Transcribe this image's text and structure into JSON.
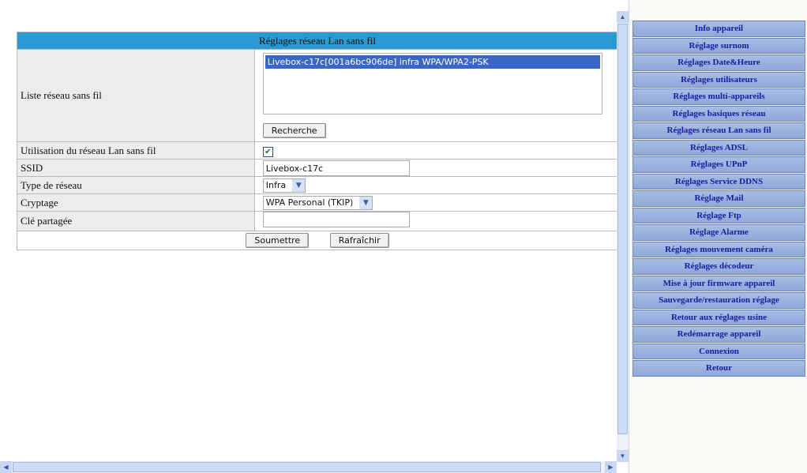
{
  "form": {
    "title": "Réglages réseau Lan sans fil",
    "wireless_list_label": "Liste réseau sans fil",
    "wireless_list_items": [
      "Livebox-c17c[001a6bc906de] infra WPA/WPA2-PSK"
    ],
    "search_button": "Recherche",
    "use_wlan_label": "Utilisation du réseau Lan sans fil",
    "use_wlan_checked": true,
    "ssid_label": "SSID",
    "ssid_value": "Livebox-c17c",
    "network_type_label": "Type de réseau",
    "network_type_value": "Infra",
    "encryption_label": "Cryptage",
    "encryption_value": "WPA Personal (TKIP)",
    "shared_key_label": "Clé partagée",
    "shared_key_value": "",
    "submit_button": "Soumettre",
    "refresh_button": "Rafraîchir"
  },
  "menu": {
    "items": [
      "Info appareil",
      "Réglage surnom",
      "Réglages Date&Heure",
      "Réglages utilisateurs",
      "Réglages multi-appareils",
      "Réglages basiques réseau",
      "Réglages réseau Lan sans fil",
      "Réglages ADSL",
      "Réglages UPnP",
      "Réglages Service DDNS",
      "Réglage Mail",
      "Réglage Ftp",
      "Réglage Alarme",
      "Réglages mouvement caméra",
      "Réglages décodeur",
      "Mise à jour firmware appareil",
      "Sauvegarde/restauration réglage",
      "Retour aux réglages usine",
      "Redémarrage appareil",
      "Connexion",
      "Retour"
    ]
  },
  "icons": {
    "checkbox": "check-icon",
    "dropdown": "chevron-down-icon",
    "scroll_up": "arrow-up-icon",
    "scroll_down": "arrow-down-icon",
    "scroll_left": "arrow-left-icon",
    "scroll_right": "arrow-right-icon"
  },
  "colors": {
    "header_bg": "#2a9ad4",
    "menu_text": "#1a1aa0",
    "menu_bg": "#9fb6e2",
    "selected_item_bg": "#3a66c8"
  }
}
